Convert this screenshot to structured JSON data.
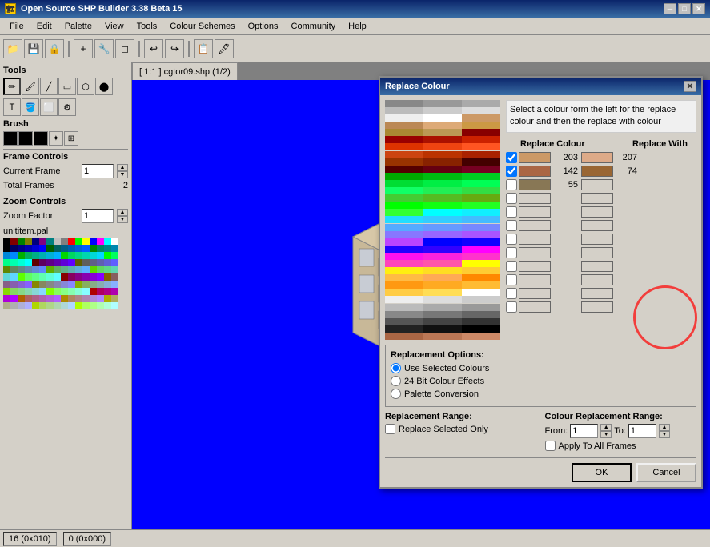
{
  "title_bar": {
    "title": "Open Source SHP Builder 3.38 Beta 15",
    "icon": "🏗",
    "btn_min": "─",
    "btn_max": "□",
    "btn_close": "✕"
  },
  "menu": {
    "items": [
      "File",
      "Edit",
      "Palette",
      "View",
      "Tools",
      "Colour Schemes",
      "Options",
      "Community",
      "Help"
    ]
  },
  "toolbar": {
    "buttons": [
      "📁",
      "💾",
      "🔒",
      "+",
      "🔧",
      "◻",
      "↩",
      "↪",
      "📋",
      "🖊"
    ]
  },
  "left_panel": {
    "tools_title": "Tools",
    "tools": [
      "✏",
      "🖌",
      "╱",
      "▭",
      "⬡",
      "⬤",
      "T",
      "🔤",
      "🪣",
      "💧",
      "⬜",
      "⚙"
    ],
    "brush_title": "Brush",
    "frame_controls": "Frame Controls",
    "current_frame_label": "Current Frame",
    "current_frame_value": "1",
    "total_frames_label": "Total Frames",
    "total_frames_value": "2",
    "zoom_controls": "Zoom Controls",
    "zoom_factor_label": "Zoom Factor",
    "zoom_factor_value": "1",
    "palette_name": "unititem.pal",
    "status_left": "16 (0x010)",
    "status_right": "0 (0x000)"
  },
  "canvas": {
    "tab_label": "[ 1:1 ] cgtor09.shp (1/2)"
  },
  "dialog": {
    "title": "Replace Colour",
    "instruction": "Select a colour form the left for the replace colour and then the replace with colour",
    "replace_colour_header": "Replace Colour",
    "replace_with_header": "Replace With",
    "rows": [
      {
        "checked": true,
        "colour_val": 203,
        "colour_rgb": "#cc9966",
        "with_val": 207,
        "with_rgb": "#ddaa88"
      },
      {
        "checked": true,
        "colour_val": 142,
        "colour_rgb": "#aa6644",
        "with_val": 74,
        "with_rgb": "#996633"
      },
      {
        "checked": false,
        "colour_val": 55,
        "colour_rgb": "#887755",
        "with_val": null,
        "with_rgb": ""
      },
      {
        "checked": false,
        "colour_val": null,
        "colour_rgb": "",
        "with_val": null,
        "with_rgb": ""
      },
      {
        "checked": false,
        "colour_val": null,
        "colour_rgb": "",
        "with_val": null,
        "with_rgb": ""
      },
      {
        "checked": false,
        "colour_val": null,
        "colour_rgb": "",
        "with_val": null,
        "with_rgb": ""
      },
      {
        "checked": false,
        "colour_val": null,
        "colour_rgb": "",
        "with_val": null,
        "with_rgb": ""
      },
      {
        "checked": false,
        "colour_val": null,
        "colour_rgb": "",
        "with_val": null,
        "with_rgb": ""
      },
      {
        "checked": false,
        "colour_val": null,
        "colour_rgb": "",
        "with_val": null,
        "with_rgb": ""
      },
      {
        "checked": false,
        "colour_val": null,
        "colour_rgb": "",
        "with_val": null,
        "with_rgb": ""
      },
      {
        "checked": false,
        "colour_val": null,
        "colour_rgb": "",
        "with_val": null,
        "with_rgb": ""
      },
      {
        "checked": false,
        "colour_val": null,
        "colour_rgb": "",
        "with_val": null,
        "with_rgb": ""
      }
    ],
    "options_title": "Replacement Options:",
    "option_use_selected": "Use Selected Colours",
    "option_24bit": "24 Bit Colour Effects",
    "option_palette": "Palette Conversion",
    "range_title": "Replacement Range:",
    "range_check": "Replace Selected Only",
    "colour_range_title": "Colour Replacement Range:",
    "from_label": "From:",
    "from_value": "1",
    "to_label": "To:",
    "to_value": "1",
    "apply_all_label": "Apply To All Frames",
    "ok_label": "OK",
    "cancel_label": "Cancel"
  },
  "palette_colours": [
    "#000000",
    "#800000",
    "#008000",
    "#808000",
    "#000080",
    "#800080",
    "#008080",
    "#c0c0c0",
    "#808080",
    "#ff0000",
    "#00ff00",
    "#ffff00",
    "#0000ff",
    "#ff00ff",
    "#00ffff",
    "#ffffff",
    "#000000",
    "#00005f",
    "#000087",
    "#0000af",
    "#0000d7",
    "#0000ff",
    "#005f00",
    "#005f5f",
    "#005f87",
    "#005faf",
    "#005fd7",
    "#005fff",
    "#008700",
    "#00875f",
    "#008787",
    "#0087af",
    "#0087d7",
    "#0087ff",
    "#00af00",
    "#00af5f",
    "#00af87",
    "#00afaf",
    "#00afd7",
    "#00afff",
    "#00d700",
    "#00d75f",
    "#00d787",
    "#00d7af",
    "#00d7d7",
    "#00d7ff",
    "#00ff00",
    "#00ff5f",
    "#00ff87",
    "#00ffaf",
    "#00ffd7",
    "#00ffff",
    "#5f0000",
    "#5f005f",
    "#5f0087",
    "#5f00af",
    "#5f00d7",
    "#5f00ff",
    "#5f5f00",
    "#5f5f5f",
    "#5f5f87",
    "#5f5faf",
    "#5f5fd7",
    "#5f5fff",
    "#5f8700",
    "#5f875f",
    "#5f8787",
    "#5f87af",
    "#5f87d7",
    "#5f87ff",
    "#5faf00",
    "#5faf5f",
    "#5faf87",
    "#5fafaf",
    "#5fafd7",
    "#5fafff",
    "#5fd700",
    "#5fd75f",
    "#5fd787",
    "#5fd7af",
    "#5fd7d7",
    "#5fd7ff",
    "#5fff00",
    "#5fff5f",
    "#5fff87",
    "#5fffaf",
    "#5fffd7",
    "#5fffff",
    "#870000",
    "#87005f",
    "#870087",
    "#8700af",
    "#8700d7",
    "#8700ff",
    "#875f00",
    "#875f5f",
    "#875f87",
    "#875faf",
    "#875fd7",
    "#875fff",
    "#878700",
    "#87875f",
    "#878787",
    "#8787af",
    "#8787d7",
    "#8787ff",
    "#87af00",
    "#87af5f",
    "#87af87",
    "#87afaf",
    "#87afd7",
    "#87afff",
    "#87d700",
    "#87d75f",
    "#87d787",
    "#87d7af",
    "#87d7d7",
    "#87d7ff",
    "#87ff00",
    "#87ff5f",
    "#87ff87",
    "#87ffaf",
    "#87ffd7",
    "#87ffff",
    "#af0000",
    "#af005f",
    "#af0087",
    "#af00af",
    "#af00d7",
    "#af00ff",
    "#af5f00",
    "#af5f5f",
    "#af5f87",
    "#af5faf",
    "#af5fd7",
    "#af5fff",
    "#af8700",
    "#af875f",
    "#af8787",
    "#af87af",
    "#af87d7",
    "#af87ff",
    "#afaf00",
    "#afaf5f",
    "#afaf87",
    "#afafaf",
    "#afafd7",
    "#afafff",
    "#afd700",
    "#afd75f",
    "#afd787",
    "#afd7af",
    "#afd7d7",
    "#afd7ff",
    "#afff00",
    "#afff5f",
    "#afff87",
    "#afffaf",
    "#afffd7",
    "#afffff",
    "#d70000",
    "#d7005f",
    "#d70087",
    "#d700af",
    "#d700d7",
    "#d700ff",
    "#d75f00",
    "#d75f5f",
    "#d75f87",
    "#d75faf",
    "#d75fd7",
    "#d75fff",
    "#d78700",
    "#d7875f",
    "#d78787",
    "#d787af",
    "#d787d7",
    "#d787ff",
    "#d7af00",
    "#d7af5f",
    "#d7af87",
    "#d7afaf",
    "#d7afd7",
    "#d7afff",
    "#d7d700",
    "#d7d75f",
    "#d7d787",
    "#d7d7af",
    "#d7d7d7",
    "#d7d7ff",
    "#d7ff00",
    "#d7ff5f",
    "#d7ff87",
    "#d7ffaf",
    "#d7ffd7",
    "#d7ffff",
    "#ff0000",
    "#ff005f",
    "#ff0087",
    "#ff00af",
    "#ff00d7",
    "#ff00ff",
    "#ff5f00",
    "#ff5f5f",
    "#ff5f87",
    "#ff5faf",
    "#ff5fd7",
    "#ff5fff",
    "#ff8700",
    "#ff875f",
    "#ff8787",
    "#ff87af",
    "#ff87d7",
    "#ff87ff",
    "#ffaf00",
    "#ffaf5f",
    "#ffaf87",
    "#ffafaf",
    "#ffafd7",
    "#ffafff",
    "#ffd700",
    "#ffd75f",
    "#ffd787",
    "#ffd7af",
    "#ffd7d7",
    "#ffd7ff",
    "#ffff00",
    "#ffff5f",
    "#ffff87",
    "#ffffaf",
    "#ffffd7",
    "#ffffff",
    "#080808",
    "#121212",
    "#1c1c1c",
    "#262626",
    "#303030",
    "#3a3a3a",
    "#444444",
    "#4e4e4e",
    "#585858",
    "#606060",
    "#666666",
    "#767676",
    "#808080",
    "#8a8a8a",
    "#949494",
    "#9e9e9e",
    "#a8a8a8",
    "#b2b2b2",
    "#bcbcbc",
    "#c6c6c6",
    "#d0d0d0",
    "#dadada",
    "#e4e4e4",
    "#eeeeee",
    "#ff0000",
    "#ff8800",
    "#ffff00",
    "#00ff00",
    "#00ffff",
    "#0000ff",
    "#8800ff",
    "#ff00ff"
  ],
  "dialog_palette": [
    [
      "#888888",
      "#777777",
      "#999999",
      "#bbbbbb",
      "#cccccc",
      "#aaaaaa",
      "#dddddd",
      "#eeeeee",
      "#c0c0c0",
      "#b0b0b0",
      "#d8d8d8",
      "#e8e8e8",
      "#a0a080",
      "#b0a888",
      "#c0b898",
      "#c8c0a0",
      "#d0c8a8",
      "#d8d0b0"
    ],
    [
      "#cc9966",
      "#bb8855",
      "#ddaa77",
      "#cc9944",
      "#aa8833",
      "#bb9955",
      "#880000",
      "#990000",
      "#aa1100",
      "#cc2200",
      "#dd3300",
      "#ee4411",
      "#ff5522",
      "#cc4411",
      "#bb3300",
      "#aa2200",
      "#993300",
      "#882200"
    ],
    [
      "#440000",
      "#550000",
      "#660011",
      "#770022",
      "#880033",
      "#990044",
      "#00aa00",
      "#00bb11",
      "#00cc22",
      "#00dd33",
      "#00ee44",
      "#00ff55",
      "#11ff66",
      "#22ee55",
      "#33dd44",
      "#44cc33",
      "#55bb22",
      "#66aa11"
    ],
    [
      "#00ff00",
      "#11ff11",
      "#22ff22",
      "#33ff33",
      "#44ff44",
      "#55ff55",
      "#00ffff",
      "#11eeff",
      "#22ddff",
      "#33ccff",
      "#44bbff",
      "#55aaff",
      "#6699ff",
      "#7788ff",
      "#8877ff",
      "#9966ff",
      "#aa55ff",
      "#bb44ff"
    ],
    [
      "#0000ff",
      "#1100ff",
      "#2200ff",
      "#3300ff",
      "#4400ff",
      "#5500ff",
      "#ff00ff",
      "#ff11ee",
      "#ff22dd",
      "#ff33cc",
      "#ff44bb",
      "#ff55aa",
      "#ffff00",
      "#ffee11",
      "#ffdd22",
      "#ffcc33",
      "#ffbb44",
      "#ffaa55"
    ],
    [
      "#ff8800",
      "#ff9911",
      "#ffaa22",
      "#ffbb33",
      "#ffcc44",
      "#ffdd55",
      "#ffffff",
      "#eeeeee",
      "#dddddd",
      "#cccccc",
      "#bbbbbb",
      "#aaaaaa",
      "#999999",
      "#888888",
      "#777777",
      "#666666",
      "#555555",
      "#444444"
    ],
    [
      "#333333",
      "#222222",
      "#111111",
      "#000000",
      "#aa6644",
      "#bb7755",
      "#cc8866",
      "#996633",
      "#887755",
      "#998866",
      "#aabb99",
      "#bbccaa",
      "#ccddbb",
      "#ddeebb",
      "#eeffcc",
      "#ffeedd",
      "#eeddcc",
      "#ddccbb"
    ]
  ]
}
